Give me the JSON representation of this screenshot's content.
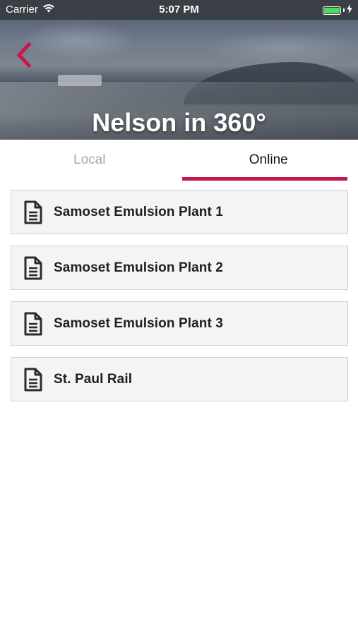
{
  "status_bar": {
    "carrier": "Carrier",
    "time": "5:07 PM",
    "battery_color": "#4cd964"
  },
  "header": {
    "title": "Nelson in 360°",
    "back_icon": "chevron-left-icon",
    "accent_color": "#c8184a"
  },
  "tabs": [
    {
      "label": "Local",
      "selected": false
    },
    {
      "label": "Online",
      "selected": true
    }
  ],
  "list": {
    "item_icon": "document-icon",
    "items": [
      {
        "label": "Samoset Emulsion Plant 1"
      },
      {
        "label": "Samoset Emulsion Plant 2"
      },
      {
        "label": "Samoset Emulsion Plant 3"
      },
      {
        "label": "St. Paul Rail"
      }
    ]
  }
}
